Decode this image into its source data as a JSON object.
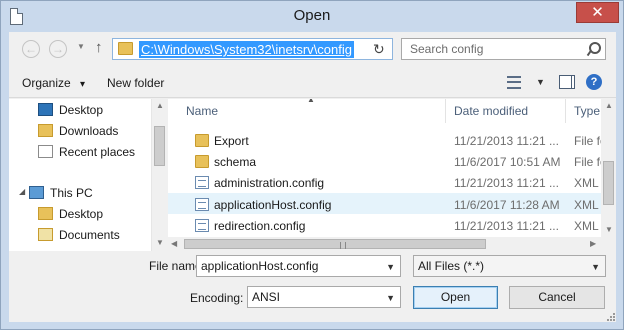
{
  "window": {
    "title": "Open",
    "close_glyph": "✕"
  },
  "navigation": {
    "back_glyph": "←",
    "forward_glyph": "→",
    "up_glyph": "↑",
    "address": "C:\\Windows\\System32\\inetsrv\\config",
    "refresh_glyph": "↻"
  },
  "search": {
    "placeholder": "Search config"
  },
  "toolbar": {
    "organize": "Organize",
    "organize_arrow": "▾",
    "new_folder": "New folder",
    "help_glyph": "?"
  },
  "nav_pane": {
    "items": [
      {
        "label": "Desktop",
        "icon": "desktop-icon"
      },
      {
        "label": "Downloads",
        "icon": "downloads-folder-icon"
      },
      {
        "label": "Recent places",
        "icon": "recent-places-icon"
      }
    ],
    "this_pc": {
      "label": "This PC",
      "icon": "computer-icon",
      "arrow": "◢"
    },
    "pc_items": [
      {
        "label": "Desktop",
        "icon": "desktop-folder-icon"
      },
      {
        "label": "Documents",
        "icon": "documents-folder-icon"
      }
    ]
  },
  "file_list": {
    "columns": {
      "name": "Name",
      "date": "Date modified",
      "type": "Type"
    },
    "rows": [
      {
        "name": "Export",
        "date": "11/21/2013 11:21 ...",
        "type": "File fol",
        "icon": "folder-icon"
      },
      {
        "name": "schema",
        "date": "11/6/2017 10:51 AM",
        "type": "File fol",
        "icon": "folder-icon"
      },
      {
        "name": "administration.config",
        "date": "11/21/2013 11:21 ...",
        "type": "XML C",
        "icon": "config-file-icon"
      },
      {
        "name": "applicationHost.config",
        "date": "11/6/2017 11:28 AM",
        "type": "XML C",
        "icon": "config-file-icon",
        "selected": true
      },
      {
        "name": "redirection.config",
        "date": "11/21/2013 11:21 ...",
        "type": "XML C",
        "icon": "config-file-icon"
      }
    ]
  },
  "bottom": {
    "file_name_label": "File name:",
    "file_name_value": "applicationHost.config",
    "filter_value": "All Files  (*.*)",
    "encoding_label": "Encoding:",
    "encoding_value": "ANSI",
    "open_button": "Open",
    "cancel_button": "Cancel"
  },
  "colors": {
    "accent": "#3399ff",
    "selection": "#e5f3fb",
    "titlebar": "#c9d9ec",
    "close": "#c7504a"
  }
}
